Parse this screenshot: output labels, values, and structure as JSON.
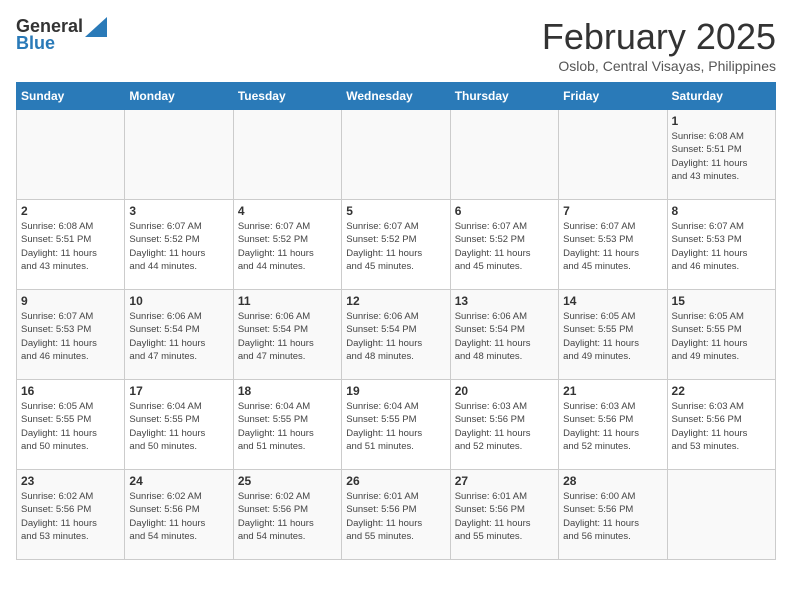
{
  "header": {
    "logo_general": "General",
    "logo_blue": "Blue",
    "month_title": "February 2025",
    "location": "Oslob, Central Visayas, Philippines"
  },
  "days_of_week": [
    "Sunday",
    "Monday",
    "Tuesday",
    "Wednesday",
    "Thursday",
    "Friday",
    "Saturday"
  ],
  "weeks": [
    [
      {
        "day": "",
        "info": ""
      },
      {
        "day": "",
        "info": ""
      },
      {
        "day": "",
        "info": ""
      },
      {
        "day": "",
        "info": ""
      },
      {
        "day": "",
        "info": ""
      },
      {
        "day": "",
        "info": ""
      },
      {
        "day": "1",
        "info": "Sunrise: 6:08 AM\nSunset: 5:51 PM\nDaylight: 11 hours\nand 43 minutes."
      }
    ],
    [
      {
        "day": "2",
        "info": "Sunrise: 6:08 AM\nSunset: 5:51 PM\nDaylight: 11 hours\nand 43 minutes."
      },
      {
        "day": "3",
        "info": "Sunrise: 6:07 AM\nSunset: 5:52 PM\nDaylight: 11 hours\nand 44 minutes."
      },
      {
        "day": "4",
        "info": "Sunrise: 6:07 AM\nSunset: 5:52 PM\nDaylight: 11 hours\nand 44 minutes."
      },
      {
        "day": "5",
        "info": "Sunrise: 6:07 AM\nSunset: 5:52 PM\nDaylight: 11 hours\nand 45 minutes."
      },
      {
        "day": "6",
        "info": "Sunrise: 6:07 AM\nSunset: 5:52 PM\nDaylight: 11 hours\nand 45 minutes."
      },
      {
        "day": "7",
        "info": "Sunrise: 6:07 AM\nSunset: 5:53 PM\nDaylight: 11 hours\nand 45 minutes."
      },
      {
        "day": "8",
        "info": "Sunrise: 6:07 AM\nSunset: 5:53 PM\nDaylight: 11 hours\nand 46 minutes."
      }
    ],
    [
      {
        "day": "9",
        "info": "Sunrise: 6:07 AM\nSunset: 5:53 PM\nDaylight: 11 hours\nand 46 minutes."
      },
      {
        "day": "10",
        "info": "Sunrise: 6:06 AM\nSunset: 5:54 PM\nDaylight: 11 hours\nand 47 minutes."
      },
      {
        "day": "11",
        "info": "Sunrise: 6:06 AM\nSunset: 5:54 PM\nDaylight: 11 hours\nand 47 minutes."
      },
      {
        "day": "12",
        "info": "Sunrise: 6:06 AM\nSunset: 5:54 PM\nDaylight: 11 hours\nand 48 minutes."
      },
      {
        "day": "13",
        "info": "Sunrise: 6:06 AM\nSunset: 5:54 PM\nDaylight: 11 hours\nand 48 minutes."
      },
      {
        "day": "14",
        "info": "Sunrise: 6:05 AM\nSunset: 5:55 PM\nDaylight: 11 hours\nand 49 minutes."
      },
      {
        "day": "15",
        "info": "Sunrise: 6:05 AM\nSunset: 5:55 PM\nDaylight: 11 hours\nand 49 minutes."
      }
    ],
    [
      {
        "day": "16",
        "info": "Sunrise: 6:05 AM\nSunset: 5:55 PM\nDaylight: 11 hours\nand 50 minutes."
      },
      {
        "day": "17",
        "info": "Sunrise: 6:04 AM\nSunset: 5:55 PM\nDaylight: 11 hours\nand 50 minutes."
      },
      {
        "day": "18",
        "info": "Sunrise: 6:04 AM\nSunset: 5:55 PM\nDaylight: 11 hours\nand 51 minutes."
      },
      {
        "day": "19",
        "info": "Sunrise: 6:04 AM\nSunset: 5:55 PM\nDaylight: 11 hours\nand 51 minutes."
      },
      {
        "day": "20",
        "info": "Sunrise: 6:03 AM\nSunset: 5:56 PM\nDaylight: 11 hours\nand 52 minutes."
      },
      {
        "day": "21",
        "info": "Sunrise: 6:03 AM\nSunset: 5:56 PM\nDaylight: 11 hours\nand 52 minutes."
      },
      {
        "day": "22",
        "info": "Sunrise: 6:03 AM\nSunset: 5:56 PM\nDaylight: 11 hours\nand 53 minutes."
      }
    ],
    [
      {
        "day": "23",
        "info": "Sunrise: 6:02 AM\nSunset: 5:56 PM\nDaylight: 11 hours\nand 53 minutes."
      },
      {
        "day": "24",
        "info": "Sunrise: 6:02 AM\nSunset: 5:56 PM\nDaylight: 11 hours\nand 54 minutes."
      },
      {
        "day": "25",
        "info": "Sunrise: 6:02 AM\nSunset: 5:56 PM\nDaylight: 11 hours\nand 54 minutes."
      },
      {
        "day": "26",
        "info": "Sunrise: 6:01 AM\nSunset: 5:56 PM\nDaylight: 11 hours\nand 55 minutes."
      },
      {
        "day": "27",
        "info": "Sunrise: 6:01 AM\nSunset: 5:56 PM\nDaylight: 11 hours\nand 55 minutes."
      },
      {
        "day": "28",
        "info": "Sunrise: 6:00 AM\nSunset: 5:56 PM\nDaylight: 11 hours\nand 56 minutes."
      },
      {
        "day": "",
        "info": ""
      }
    ]
  ]
}
